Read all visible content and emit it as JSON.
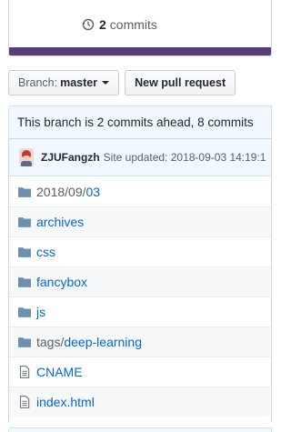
{
  "stats": {
    "commits_count": "2",
    "commits_label": "commits",
    "lang_color": "#563d7c"
  },
  "toolbar": {
    "branch_label": "Branch:",
    "branch_value": "master",
    "new_pr_label": "New pull request"
  },
  "branch_info": {
    "text": "This branch is 2 commits ahead, 8 commits"
  },
  "commit": {
    "author": "ZJUFangzh",
    "message": "Site updated: 2018-09-03 14:19:1"
  },
  "files": [
    {
      "icon": "folder-icon",
      "prefix": "2018/09/",
      "name": "03"
    },
    {
      "icon": "folder-icon",
      "prefix": "",
      "name": "archives"
    },
    {
      "icon": "folder-icon",
      "prefix": "",
      "name": "css"
    },
    {
      "icon": "folder-icon",
      "prefix": "",
      "name": "fancybox"
    },
    {
      "icon": "folder-icon",
      "prefix": "",
      "name": "js"
    },
    {
      "icon": "folder-icon",
      "prefix": "tags/",
      "name": "deep-learning"
    },
    {
      "icon": "file-icon",
      "prefix": "",
      "name": "CNAME"
    },
    {
      "icon": "file-icon",
      "prefix": "",
      "name": "index.html"
    }
  ]
}
